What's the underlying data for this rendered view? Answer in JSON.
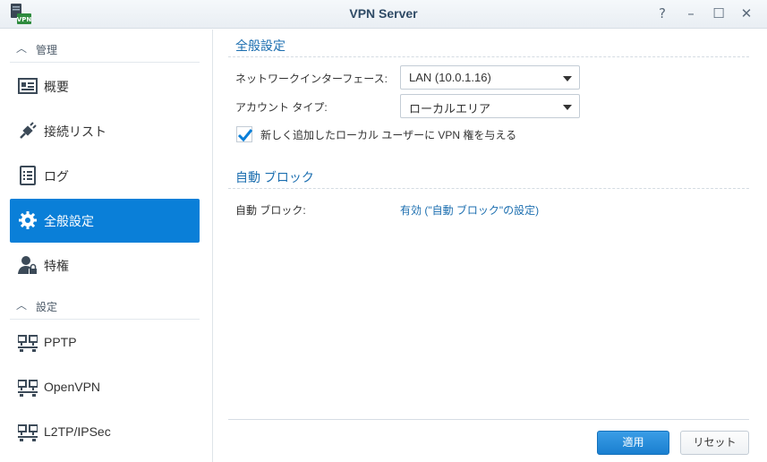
{
  "window": {
    "title": "VPN Server",
    "icon_badge": "VPN",
    "controls": {
      "help": "?",
      "minimize": "–",
      "maximize": "☐",
      "close": "✕"
    }
  },
  "sidebar": {
    "sections": [
      {
        "label": "管理",
        "items": [
          {
            "label": "概要",
            "icon": "overview-icon"
          },
          {
            "label": "接続リスト",
            "icon": "plug-icon"
          },
          {
            "label": "ログ",
            "icon": "log-icon"
          },
          {
            "label": "全般設定",
            "icon": "gear-icon",
            "active": true
          },
          {
            "label": "特権",
            "icon": "user-lock-icon"
          }
        ]
      },
      {
        "label": "設定",
        "items": [
          {
            "label": "PPTP",
            "icon": "network-icon"
          },
          {
            "label": "OpenVPN",
            "icon": "network-icon"
          },
          {
            "label": "L2TP/IPSec",
            "icon": "network-icon"
          }
        ]
      }
    ]
  },
  "general": {
    "title": "全般設定",
    "interface_label": "ネットワークインターフェース:",
    "interface_value": "LAN (10.0.1.16)",
    "account_label": "アカウント タイプ:",
    "account_value": "ローカルエリア",
    "grant_label": "新しく追加したローカル ユーザーに VPN 権を与える",
    "grant_checked": true
  },
  "autoblock": {
    "title": "自動 ブロック",
    "label": "自動 ブロック:",
    "value": "有効 (\"自動 ブロック\"の設定)"
  },
  "buttons": {
    "apply": "適用",
    "reset": "リセット"
  },
  "colors": {
    "accent": "#0a7fd8",
    "link": "#1d6fb0",
    "title": "#2f4b66"
  }
}
